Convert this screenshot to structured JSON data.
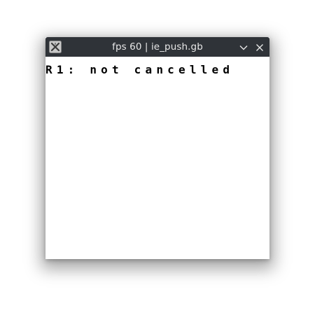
{
  "window": {
    "title": "fps 60 | ie_push.gb",
    "icons": {
      "app": "app-icon",
      "minimize": "chevron-down-icon",
      "close": "close-icon"
    }
  },
  "screen": {
    "lines": [
      "R1: not cancelled"
    ],
    "background": "#ffffff",
    "text_color": "#000000"
  },
  "colors": {
    "titlebar": "#2f3338",
    "title_text": "#e8e8e8"
  }
}
